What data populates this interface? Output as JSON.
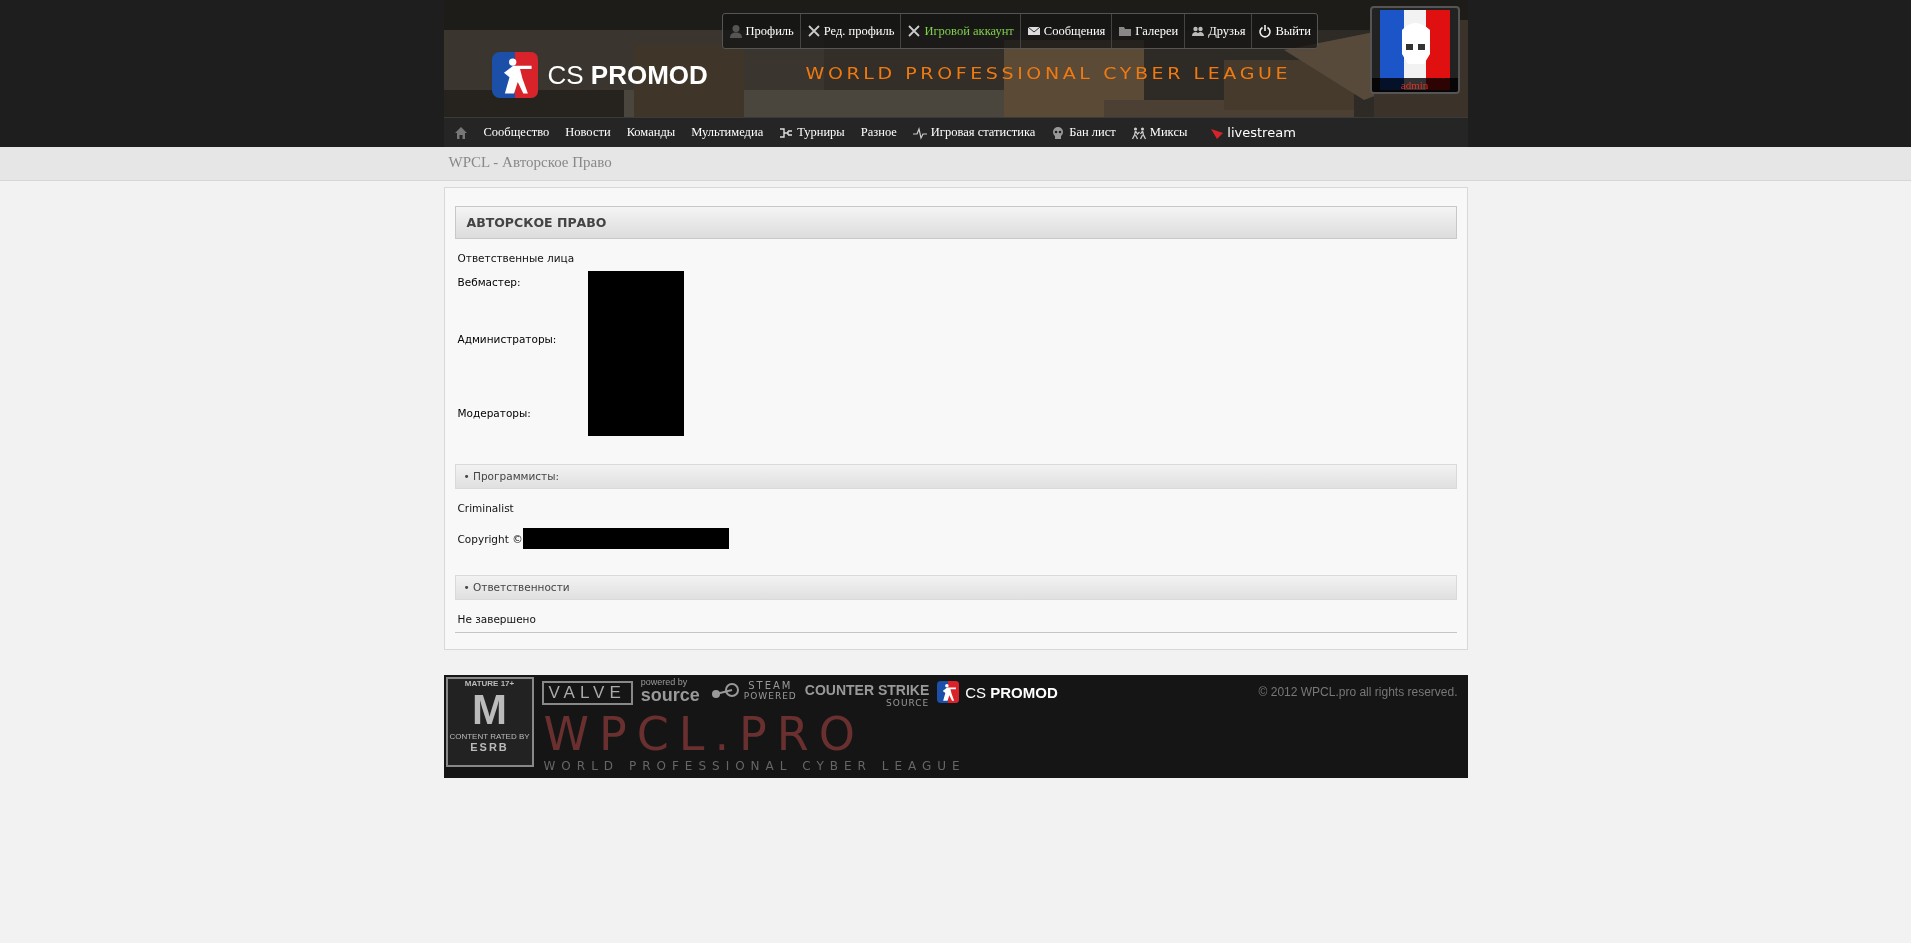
{
  "header": {
    "logo": {
      "prefix": "CS",
      "name": "PROMOD"
    },
    "tagline": "WORLD PROFESSIONAL CYBER LEAGUE",
    "user_menu": [
      {
        "label": "Профиль",
        "highlighted": false
      },
      {
        "label": "Ред. профиль",
        "highlighted": false
      },
      {
        "label": "Игровой аккаунт",
        "highlighted": true
      },
      {
        "label": "Сообщения",
        "highlighted": false
      },
      {
        "label": "Галереи",
        "highlighted": false
      },
      {
        "label": "Друзья",
        "highlighted": false
      },
      {
        "label": "Выйти",
        "highlighted": false
      }
    ],
    "avatar": {
      "username": "admin"
    }
  },
  "nav": {
    "items": [
      {
        "kind": "icon"
      },
      {
        "kind": "link",
        "label": "Сообщество"
      },
      {
        "kind": "link",
        "label": "Новости"
      },
      {
        "kind": "link",
        "label": "Команды"
      },
      {
        "kind": "link",
        "label": "Мультимедиа"
      },
      {
        "kind": "link",
        "label": "Турниры"
      },
      {
        "kind": "link",
        "label": "Разное"
      },
      {
        "kind": "link",
        "label": "Игровая статистика"
      },
      {
        "kind": "link",
        "label": "Бан лист"
      },
      {
        "kind": "link",
        "label": "Миксы"
      },
      {
        "kind": "logo",
        "label": "livestream"
      }
    ]
  },
  "breadcrumb": "WPCL - Авторское Право",
  "panel": {
    "title": "АВТОРСКОЕ ПРАВО",
    "blocks": [
      {
        "kind": "text",
        "text": "Ответственные лица"
      },
      {
        "kind": "roles",
        "roles": [
          "Вебмастер:",
          "Администраторы:",
          "Модераторы:"
        ],
        "redacted": true
      },
      {
        "kind": "section",
        "title": "• Программисты:"
      },
      {
        "kind": "text",
        "text": "Criminalist"
      },
      {
        "kind": "copyright",
        "text": "Copyright ©",
        "redacted": true
      },
      {
        "kind": "section",
        "title": "• Ответственности"
      },
      {
        "kind": "text",
        "text": "Не завершено",
        "rule": true
      }
    ]
  },
  "footer": {
    "logos": [
      {
        "kind": "esrb",
        "lines": [
          "MATURE 17+",
          "M",
          "CONTENT RATED BY",
          "ESRB"
        ]
      },
      {
        "kind": "valve",
        "lines": [
          "VALVE"
        ]
      },
      {
        "kind": "source",
        "lines": [
          "powered by",
          "source"
        ]
      },
      {
        "kind": "steam",
        "lines": [
          "STEAM",
          "POWERED"
        ]
      },
      {
        "kind": "counterstrike",
        "lines": [
          "COUNTER",
          "STRIKE",
          "SOURCE"
        ]
      },
      {
        "kind": "promod",
        "lines": [
          "CS",
          "PROMOD"
        ]
      }
    ],
    "backdrop_title": "WPCL.PRO",
    "backdrop_tagline": "WORLD PROFESSIONAL CYBER LEAGUE",
    "copyright": "© 2012 WPCL.pro all rights reserved."
  }
}
